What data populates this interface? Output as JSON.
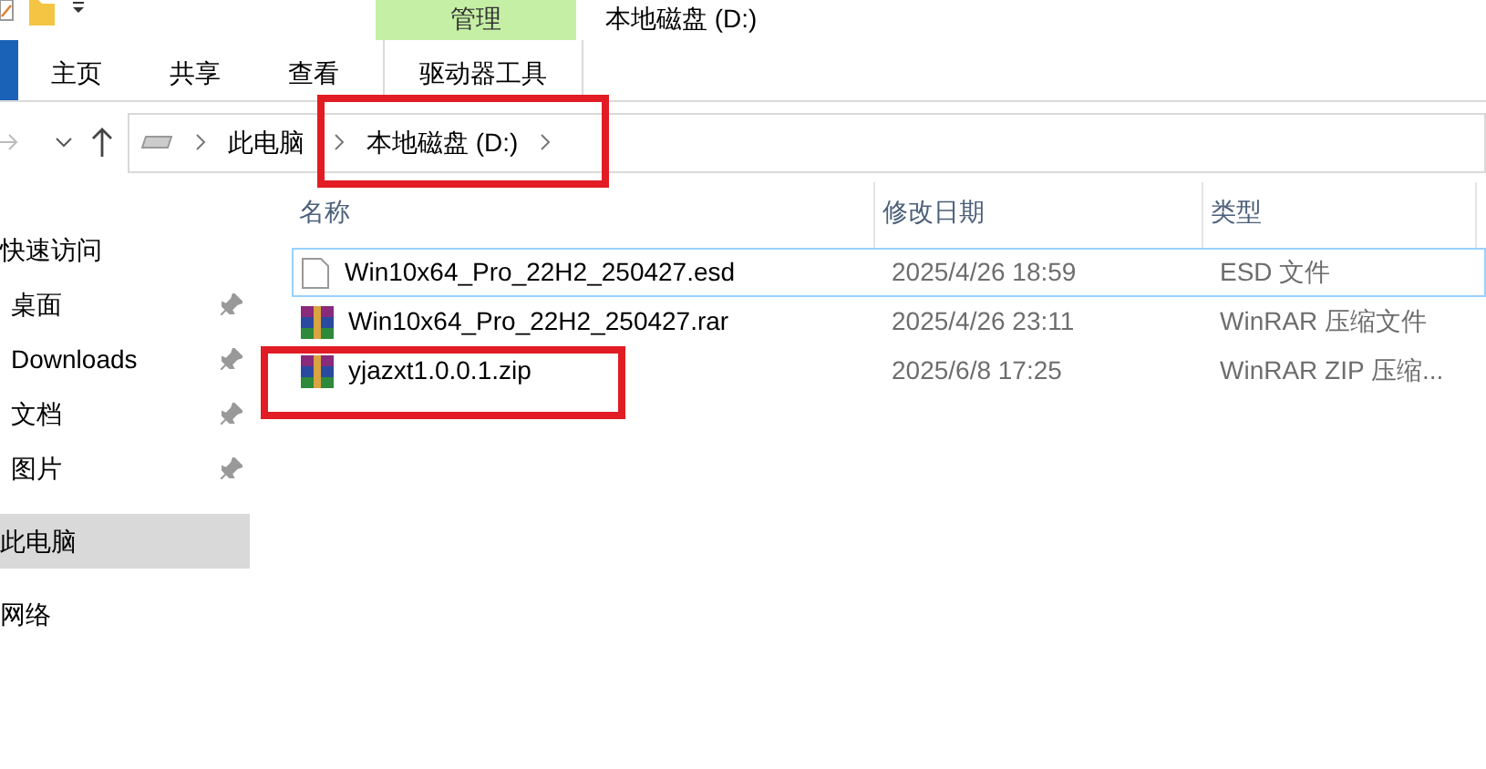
{
  "window": {
    "title": "本地磁盘 (D:)",
    "context_tab": "管理"
  },
  "ribbon_tabs": [
    {
      "label": "主页",
      "selected": false
    },
    {
      "label": "共享",
      "selected": false
    },
    {
      "label": "查看",
      "selected": false
    },
    {
      "label": "驱动器工具",
      "selected": false
    }
  ],
  "address_bar": {
    "crumbs": [
      {
        "label": "此电脑",
        "highlighted": false
      },
      {
        "label": "本地磁盘 (D:)",
        "highlighted": true
      }
    ]
  },
  "sidebar": {
    "items": [
      {
        "label": "快速访问",
        "kind": "header",
        "pinned": false,
        "selected": false
      },
      {
        "label": "桌面",
        "kind": "item",
        "pinned": true,
        "selected": false
      },
      {
        "label": "Downloads",
        "kind": "item",
        "pinned": true,
        "selected": false
      },
      {
        "label": "文档",
        "kind": "item",
        "pinned": true,
        "selected": false
      },
      {
        "label": "图片",
        "kind": "item",
        "pinned": true,
        "selected": false
      },
      {
        "label": "此电脑",
        "kind": "header",
        "pinned": false,
        "selected": true
      },
      {
        "label": "网络",
        "kind": "header",
        "pinned": false,
        "selected": false
      }
    ]
  },
  "table": {
    "columns": [
      "名称",
      "修改日期",
      "类型"
    ],
    "rows": [
      {
        "name": "Win10x64_Pro_22H2_250427.esd",
        "date": "2025/4/26 18:59",
        "type": "ESD 文件",
        "kind": "file",
        "focused": true,
        "highlighted": false
      },
      {
        "name": "Win10x64_Pro_22H2_250427.rar",
        "date": "2025/4/26 23:11",
        "type": "WinRAR 压缩文件",
        "kind": "archive",
        "focused": false,
        "highlighted": false
      },
      {
        "name": "yjazxt1.0.0.1.zip",
        "date": "2025/6/8 17:25",
        "type": "WinRAR ZIP 压缩...",
        "kind": "archive",
        "focused": false,
        "highlighted": true
      }
    ]
  }
}
